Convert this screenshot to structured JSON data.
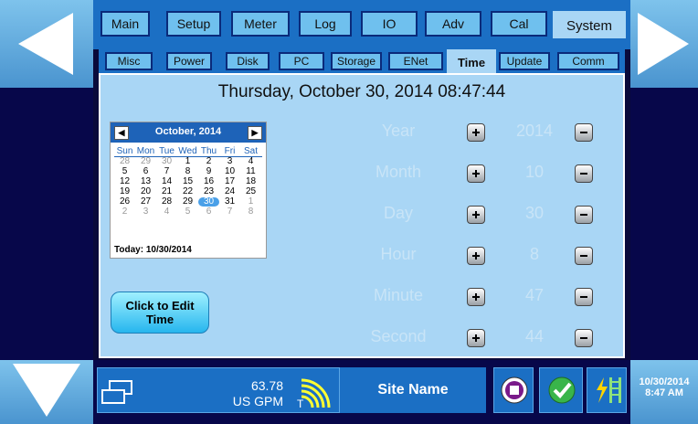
{
  "tabs_main": [
    "Main",
    "Setup",
    "Meter",
    "Log",
    "IO",
    "Adv",
    "Cal",
    "System"
  ],
  "tabs_main_active": "System",
  "tabs_sub": [
    "Misc",
    "Power",
    "Disk",
    "PC",
    "Storage",
    "ENet",
    "Time",
    "Update",
    "Comm"
  ],
  "tabs_sub_active": "Time",
  "datetime": "Thursday, October 30, 2014 08:47:44",
  "calendar": {
    "month_title": "October, 2014",
    "days_of_week": [
      "Sun",
      "Mon",
      "Tue",
      "Wed",
      "Thu",
      "Fri",
      "Sat"
    ],
    "weeks": [
      [
        "28",
        "29",
        "30",
        "1",
        "2",
        "3",
        "4"
      ],
      [
        "5",
        "6",
        "7",
        "8",
        "9",
        "10",
        "11"
      ],
      [
        "12",
        "13",
        "14",
        "15",
        "16",
        "17",
        "18"
      ],
      [
        "19",
        "20",
        "21",
        "22",
        "23",
        "24",
        "25"
      ],
      [
        "26",
        "27",
        "28",
        "29",
        "30",
        "31",
        "1"
      ],
      [
        "2",
        "3",
        "4",
        "5",
        "6",
        "7",
        "8"
      ]
    ],
    "selected": "30",
    "today_label": "Today: 10/30/2014"
  },
  "edit_button_label": "Click to Edit Time",
  "fields": [
    {
      "label": "Year",
      "value": "2014"
    },
    {
      "label": "Month",
      "value": "10"
    },
    {
      "label": "Day",
      "value": "30"
    },
    {
      "label": "Hour",
      "value": "8"
    },
    {
      "label": "Minute",
      "value": "47"
    },
    {
      "label": "Second",
      "value": "44"
    }
  ],
  "status": {
    "flow_value": "63.78",
    "flow_unit": "US GPM",
    "signal_label": "T",
    "site_name": "Site Name",
    "date": "10/30/2014",
    "time": "8:47 AM"
  },
  "icons": {
    "left_nav": "arrow-left-icon",
    "right_nav": "arrow-right-icon",
    "down_nav": "arrow-down-icon",
    "windows": "windows-icon",
    "signal": "signal-icon",
    "stop": "stop-icon",
    "ok": "check-icon",
    "ladder": "ladder-icon"
  },
  "colors": {
    "accent": "#1b6fc4",
    "panel": "#a9d6f5",
    "tab": "#6fc0ee"
  }
}
